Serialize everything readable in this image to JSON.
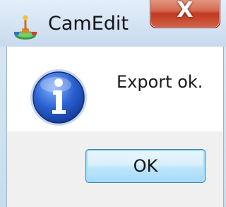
{
  "window": {
    "title": "CamEdit",
    "app_icon": "camedit-app-icon",
    "close_glyph": "X",
    "close_icon": "close-icon"
  },
  "dialog": {
    "message": "Export ok.",
    "icon": "info-icon",
    "ok_label": "OK"
  },
  "colors": {
    "titlebar": "#d3e2f3",
    "close_button": "#c0391f",
    "info_icon_blue": "#1e4fb6",
    "button_border": "#3c7fb1"
  }
}
